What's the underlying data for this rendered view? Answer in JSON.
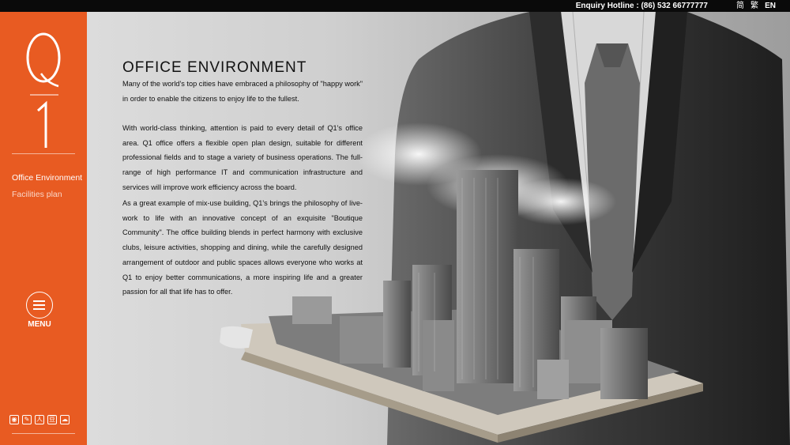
{
  "topbar": {
    "hotline": "Enquiry Hotline : (86) 532 66777777",
    "lang_simplified": "简",
    "lang_traditional": "繁",
    "lang_en": "EN"
  },
  "sidebar": {
    "logo_text": "Q1",
    "items": [
      {
        "label": "Office Environment",
        "active": true
      },
      {
        "label": "Facilities plan",
        "active": false
      }
    ],
    "menu_label": "MENU",
    "social_icons": [
      "weibo-icon",
      "wechat-moments-icon",
      "renren-icon",
      "douban-icon",
      "wechat-icon"
    ]
  },
  "main": {
    "title": "OFFICE ENVIRONMENT",
    "paragraphs": [
      "Many of the world's top cities have embraced a philosophy of \"happy work\" in order to enable the citizens to enjoy life to the fullest.",
      "With world-class thinking, attention is paid to every detail of Q1's office area. Q1 office offers a flexible open plan design, suitable for different professional fields and to stage a variety of business operations. The full-range of high performance IT and communication infrastructure and services will improve work efficiency across the board.",
      "As a great example of mix-use building, Q1's brings the philosophy of live-work to life with an innovative concept of an exquisite \"Boutique Community\". The office building blends in perfect harmony with exclusive clubs, leisure activities, shopping and dining, while the carefully designed arrangement of outdoor and public spaces allows everyone who works at Q1 to enjoy better communications, a more inspiring life and a greater passion for all that life has to offer."
    ]
  },
  "colors": {
    "sidebar": "#e85b22",
    "topbar": "#0a0a0a"
  }
}
